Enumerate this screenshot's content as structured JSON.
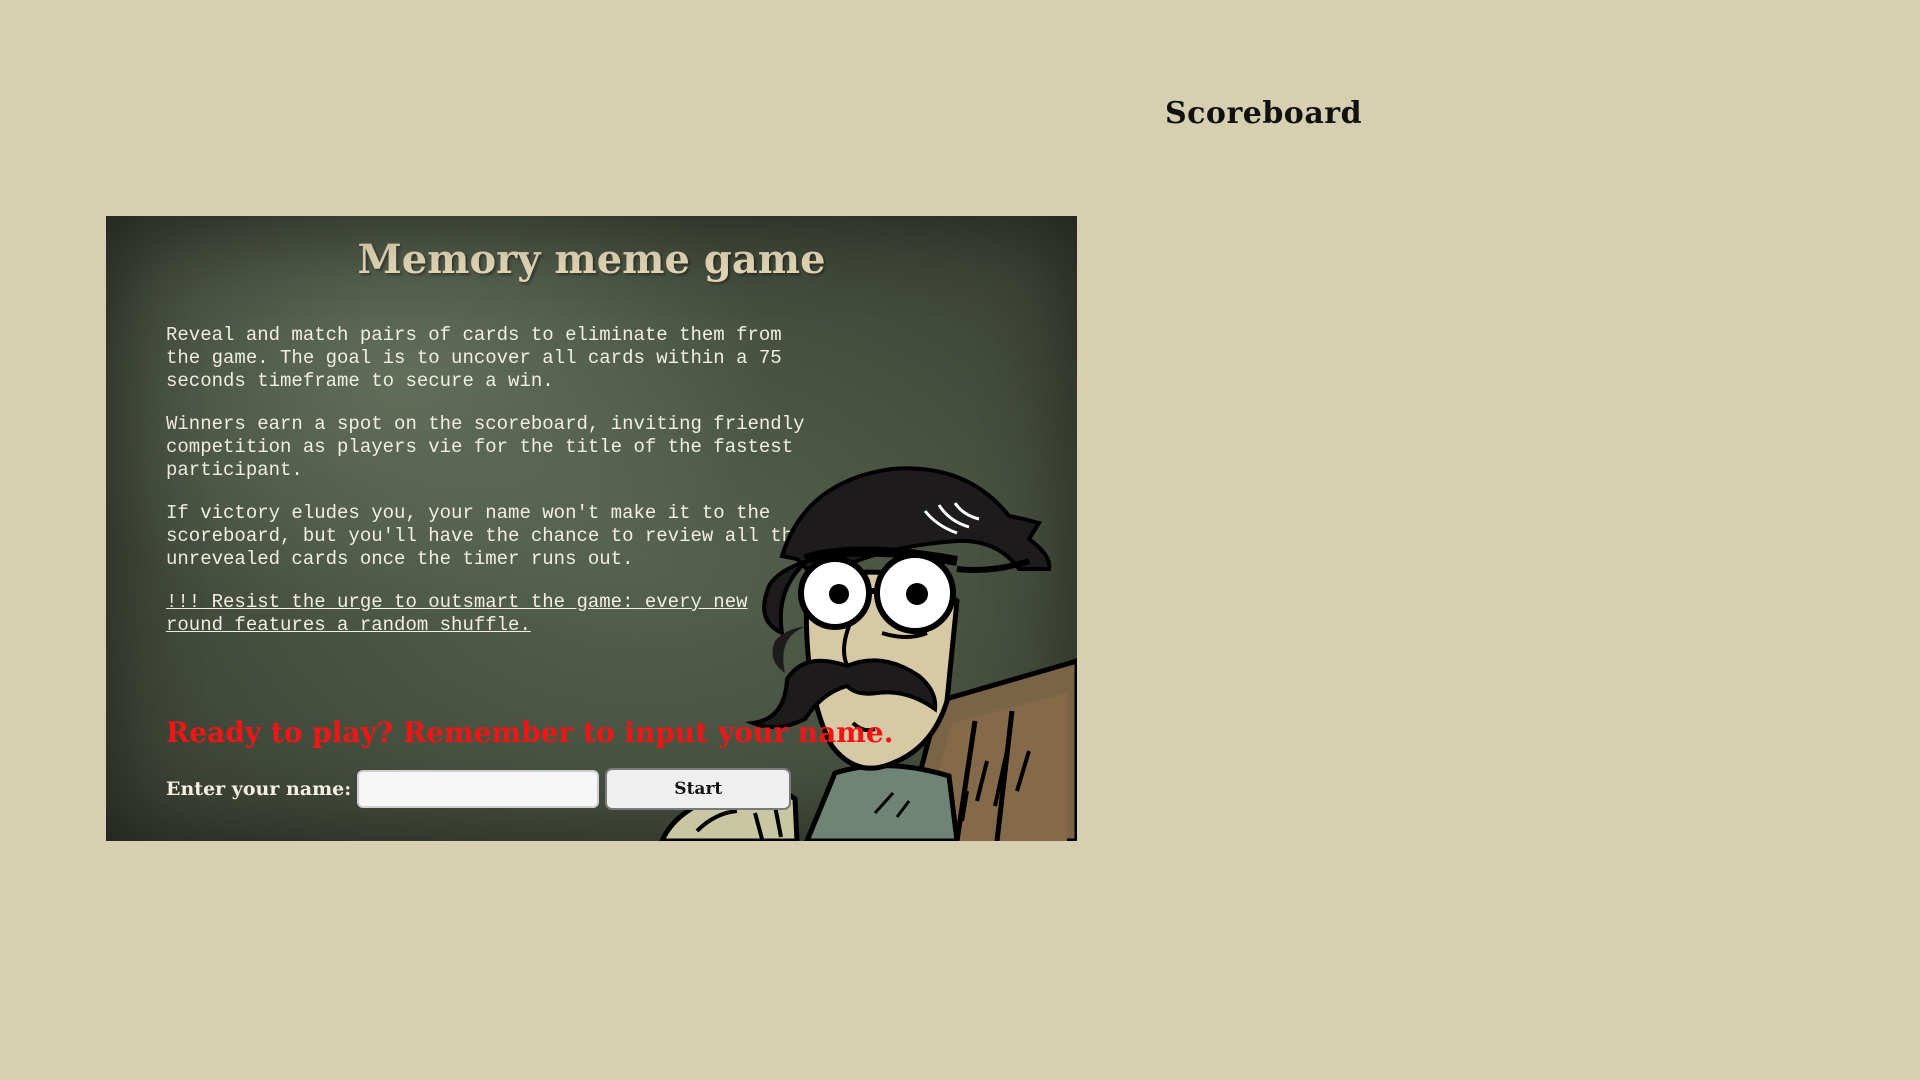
{
  "scoreboard": {
    "title": "Scoreboard"
  },
  "game": {
    "title": "Memory meme game",
    "rules": [
      "Reveal and match pairs of cards to eliminate them from the game. The goal is to uncover all cards within a 75 seconds timeframe to secure a win.",
      "Winners earn a spot on the scoreboard, inviting friendly competition as players vie for the title of the fastest participant.",
      "If victory eludes you, your name won't make it to the scoreboard, but you'll have the chance to review all the unrevealed cards once the timer runs out."
    ],
    "warning": "!!! Resist the urge to outsmart the game: every new round features a random shuffle.",
    "ready_prompt": "Ready to play? Remember to input your name.",
    "name_label": "Enter your name:",
    "name_value": "",
    "start_label": "Start"
  },
  "colors": {
    "page_background": "#d6d0b0",
    "panel_background": "#4c5644",
    "title_color": "#e9dcbb",
    "prompt_color": "#f01616"
  },
  "icons": {
    "illustration": "suspicious-mustache-man-meme"
  }
}
